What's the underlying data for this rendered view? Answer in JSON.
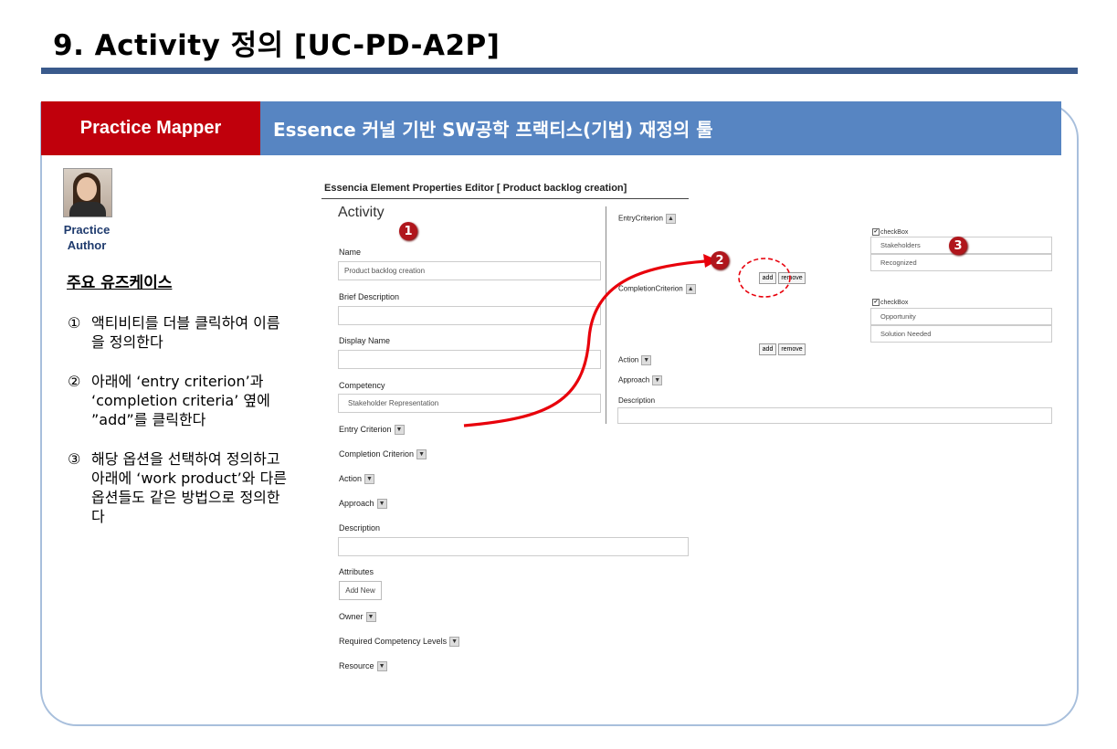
{
  "page": {
    "title": "9. Activity 정의 [UC-PD-A2P]"
  },
  "banner": {
    "left": "Practice Mapper",
    "right": "Essence 커널 기반 SW공학 프랙티스(기법) 재정의 툴"
  },
  "author": {
    "line1": "Practice",
    "line2": "Author"
  },
  "usecases": {
    "title": "주요 유즈케이스",
    "steps": [
      {
        "num": "①",
        "text": "액티비티를 더블 클릭하여 이름을 정의한다"
      },
      {
        "num": "②",
        "text": "아래에 ‘entry criterion’과 ‘completion criteria’ 옆에 ”add”를 클릭한다"
      },
      {
        "num": "③",
        "text": "해당 옵션을 선택하여 정의하고 아래에 ‘work product’와 다른 옵션들도 같은 방법으로 정의한다"
      }
    ]
  },
  "editor": {
    "title": "Essencia Element Properties Editor [ Product backlog creation]",
    "heading": "Activity",
    "name_label": "Name",
    "name_value": "Product backlog creation",
    "brief_label": "Brief Description",
    "brief_value": "",
    "display_label": "Display Name",
    "display_value": "",
    "competency_label": "Competency",
    "competency_value": "Stakeholder Representation",
    "entry_label": "Entry Criterion",
    "completion_label": "Completion Criterion",
    "action_label": "Action",
    "approach_label": "Approach",
    "description_label": "Description",
    "attributes_label": "Attributes",
    "add_new": "Add New",
    "owner_label": "Owner",
    "req_comp_label": "Required Competency Levels",
    "resource_label": "Resource",
    "dropdown_glyph": "▼",
    "up_glyph": "▲"
  },
  "detail": {
    "entry_label": "EntryCriterion",
    "completion_label": "CompletionCriterion",
    "action_label": "Action",
    "approach_label": "Approach",
    "description_label": "Description",
    "add": "add",
    "remove": "remove",
    "checkbox_label": "checkBox",
    "check_glyph": "✔",
    "entry_items": [
      "Stakeholders",
      "Recognized"
    ],
    "completion_items": [
      "Opportunity",
      "Solution Needed"
    ]
  },
  "markers": [
    "1",
    "2",
    "3"
  ],
  "colors": {
    "title_rule": "#3a5a8c",
    "banner_red": "#c0000c",
    "banner_blue": "#5785c2",
    "arrow": "#e8000b"
  }
}
